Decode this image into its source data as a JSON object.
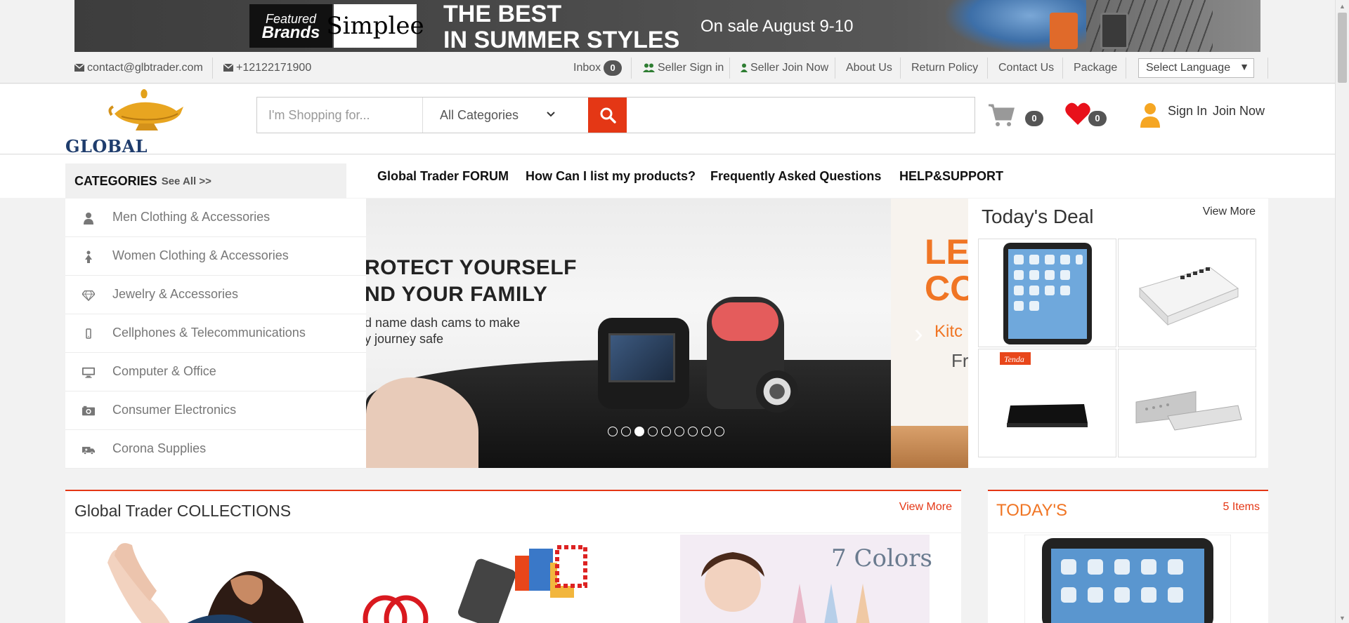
{
  "banner": {
    "brand_featured": [
      "Featured",
      "Brands"
    ],
    "brand_name": "Simplee",
    "headline": [
      "THE BEST",
      "IN SUMMER STYLES"
    ],
    "sale": "On sale August 9-10"
  },
  "topbar": {
    "email": "contact@glbtrader.com",
    "phone": "+12122171900",
    "inbox_label": "Inbox",
    "inbox_count": "0",
    "seller_signin": "Seller Sign in",
    "seller_join": "Seller Join Now",
    "about": "About Us",
    "return_policy": "Return Policy",
    "contact": "Contact Us",
    "package": "Package",
    "language": "Select Language"
  },
  "header": {
    "logo_text": "GLOBAL TRADER",
    "search_placeholder": "I'm Shopping for...",
    "category_selected": "All Categories",
    "cart_count": "0",
    "wishlist_count": "0",
    "sign_in": "Sign In",
    "join_now": "Join Now"
  },
  "nav": {
    "categories_label": "CATEGORIES",
    "see_all": "See All >>",
    "links": [
      "Global Trader FORUM",
      "How Can I list my products?",
      "Frequently Asked Questions",
      "HELP&SUPPORT"
    ]
  },
  "categories": [
    {
      "label": "Men Clothing & Accessories",
      "icon": "user-icon"
    },
    {
      "label": "Women Clothing & Accessories",
      "icon": "female-icon"
    },
    {
      "label": "Jewelry & Accessories",
      "icon": "diamond-icon"
    },
    {
      "label": "Cellphones & Telecommunications",
      "icon": "mobile-icon"
    },
    {
      "label": "Computer & Office",
      "icon": "desktop-icon"
    },
    {
      "label": "Consumer Electronics",
      "icon": "camera-icon"
    },
    {
      "label": "Corona Supplies",
      "icon": "ambulance-icon"
    }
  ],
  "slider": {
    "slide1_title": [
      "ROTECT YOURSELF",
      "ND YOUR FAMILY"
    ],
    "slide1_sub": [
      "d name dash cams to make",
      "y journey safe"
    ],
    "slide2_title": [
      "LE",
      "CO"
    ],
    "slide2_sub": "Kitc",
    "slide2_sub2": "Fr",
    "dot_count": 9,
    "active_dot": 3
  },
  "deal": {
    "title": "Today's Deal",
    "view_more": "View More",
    "items": [
      "tablet",
      "network-switch",
      "tenda-router",
      "speaker"
    ],
    "tenda_label": "Tenda"
  },
  "collections": {
    "title": "Global Trader COLLECTIONS",
    "view_more": "View More",
    "colors_label": "7 Colors"
  },
  "today": {
    "title": "TODAY'S",
    "count": "5 Items"
  },
  "colors": {
    "accent": "#e43715",
    "orange": "#f07524",
    "user_icon": "#f5a623",
    "heart": "#e8111b"
  }
}
